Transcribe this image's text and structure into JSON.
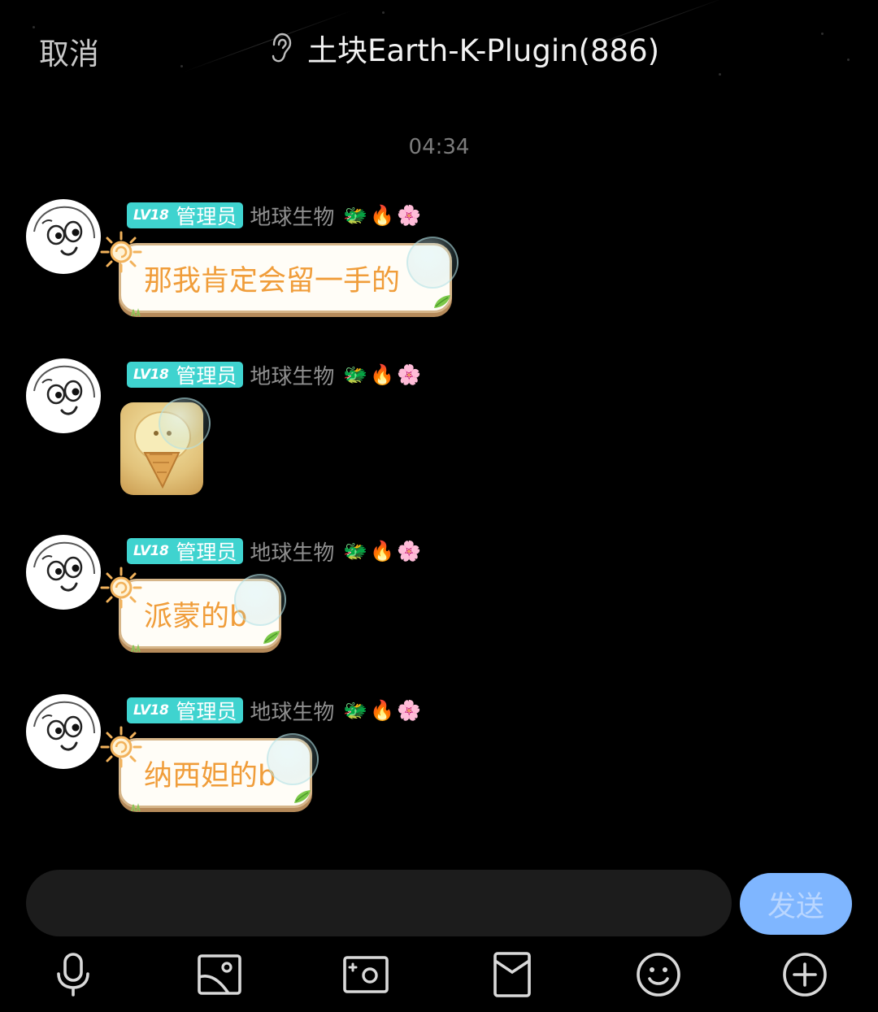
{
  "header": {
    "cancel_label": "取消",
    "title": "土块Earth-K-Plugin(886)",
    "mode_icon": "ear-icon"
  },
  "timestamp": "04:34",
  "messages": [
    {
      "level": "LV18",
      "role": "管理员",
      "nickname": "地球生物",
      "emojis": [
        "🐲",
        "🔥",
        "🌸"
      ],
      "type": "text",
      "text": "那我肯定会留一手的"
    },
    {
      "level": "LV18",
      "role": "管理员",
      "nickname": "地球生物",
      "emojis": [
        "🐲",
        "🔥",
        "🌸"
      ],
      "type": "sticker",
      "sticker_icon": "ice-cream-sticker"
    },
    {
      "level": "LV18",
      "role": "管理员",
      "nickname": "地球生物",
      "emojis": [
        "🐲",
        "🔥",
        "🌸"
      ],
      "type": "text",
      "text": "派蒙的b"
    },
    {
      "level": "LV18",
      "role": "管理员",
      "nickname": "地球生物",
      "emojis": [
        "🐲",
        "🔥",
        "🌸"
      ],
      "type": "text",
      "text": "纳西妲的b"
    }
  ],
  "composer": {
    "input_value": "",
    "send_label": "发送"
  },
  "toolbar": {
    "icons": [
      "microphone-icon",
      "image-icon",
      "camera-icon",
      "red-packet-icon",
      "emoji-icon",
      "plus-icon"
    ]
  },
  "colors": {
    "background": "#000000",
    "level_badge": "#3fd3cf",
    "bubble_text": "#f09d3a",
    "bubble_border": "#d6b68a",
    "send_button": "#7fb6ff"
  }
}
